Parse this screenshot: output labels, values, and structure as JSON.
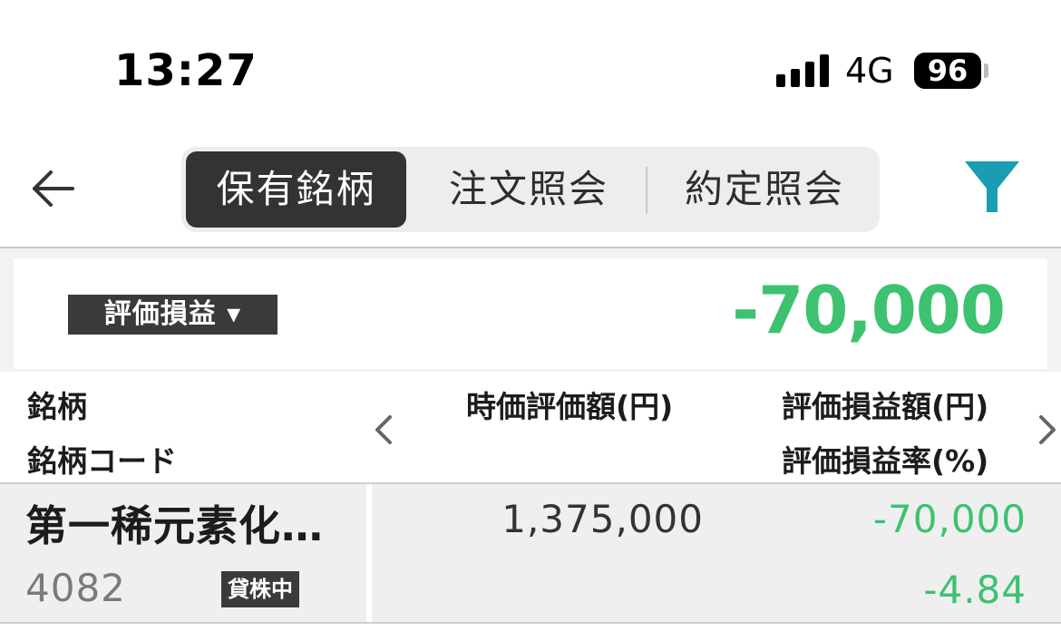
{
  "status_bar": {
    "time": "13:27",
    "network": "4G",
    "battery": "96"
  },
  "nav": {
    "back_icon": "arrow-left-icon",
    "tabs": [
      {
        "label": "保有銘柄",
        "active": true
      },
      {
        "label": "注文照会",
        "active": false
      },
      {
        "label": "約定照会",
        "active": false
      }
    ],
    "filter_icon": "filter-funnel-icon",
    "filter_color": "#1a9db3"
  },
  "summary": {
    "selector_label": "評価損益",
    "total": "-70,000"
  },
  "table": {
    "headers": {
      "name": "銘柄",
      "code": "銘柄コード",
      "market_value": "時価評価額(円)",
      "pl_amount": "評価損益額(円)",
      "pl_rate": "評価損益率(%)"
    },
    "rows": [
      {
        "name": "第一稀元素化…",
        "code": "4082",
        "badge": "貸株中",
        "market_value": "1,375,000",
        "pl_amount": "-70,000",
        "pl_rate": "-4.84"
      }
    ]
  },
  "colors": {
    "gain_loss": "#3cc270",
    "active_tab": "#333333"
  }
}
